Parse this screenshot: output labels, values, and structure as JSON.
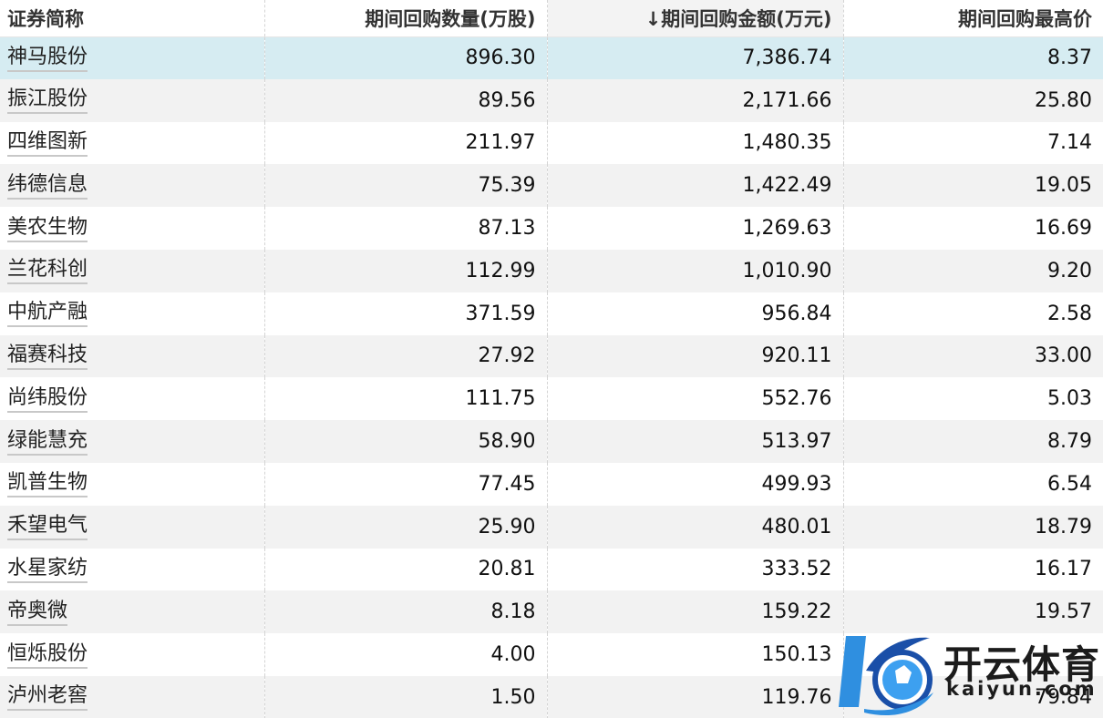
{
  "table": {
    "headers": {
      "name": "证券简称",
      "quantity": "期间回购数量(万股)",
      "amount": "↓期间回购金额(万元)",
      "max_price": "期间回购最高价"
    },
    "sorted_column": "amount",
    "rows": [
      {
        "name": "神马股份",
        "quantity": "896.30",
        "amount": "7,386.74",
        "max_price": "8.37",
        "selected": true
      },
      {
        "name": "振江股份",
        "quantity": "89.56",
        "amount": "2,171.66",
        "max_price": "25.80"
      },
      {
        "name": "四维图新",
        "quantity": "211.97",
        "amount": "1,480.35",
        "max_price": "7.14"
      },
      {
        "name": "纬德信息",
        "quantity": "75.39",
        "amount": "1,422.49",
        "max_price": "19.05"
      },
      {
        "name": "美农生物",
        "quantity": "87.13",
        "amount": "1,269.63",
        "max_price": "16.69"
      },
      {
        "name": "兰花科创",
        "quantity": "112.99",
        "amount": "1,010.90",
        "max_price": "9.20"
      },
      {
        "name": "中航产融",
        "quantity": "371.59",
        "amount": "956.84",
        "max_price": "2.58"
      },
      {
        "name": "福赛科技",
        "quantity": "27.92",
        "amount": "920.11",
        "max_price": "33.00"
      },
      {
        "name": "尚纬股份",
        "quantity": "111.75",
        "amount": "552.76",
        "max_price": "5.03"
      },
      {
        "name": "绿能慧充",
        "quantity": "58.90",
        "amount": "513.97",
        "max_price": "8.79"
      },
      {
        "name": "凯普生物",
        "quantity": "77.45",
        "amount": "499.93",
        "max_price": "6.54"
      },
      {
        "name": "禾望电气",
        "quantity": "25.90",
        "amount": "480.01",
        "max_price": "18.79"
      },
      {
        "name": "水星家纺",
        "quantity": "20.81",
        "amount": "333.52",
        "max_price": "16.17"
      },
      {
        "name": "帝奥微",
        "quantity": "8.18",
        "amount": "159.22",
        "max_price": "19.57"
      },
      {
        "name": "恒烁股份",
        "quantity": "4.00",
        "amount": "150.13",
        "max_price": ""
      },
      {
        "name": "泸州老窖",
        "quantity": "1.50",
        "amount": "119.76",
        "max_price": "79.84"
      }
    ]
  },
  "watermark": {
    "brand": "开云体育",
    "domain": "kaiyun.com",
    "colors": {
      "logo_blue": "#2f8fe0",
      "logo_dark": "#1a4fa8"
    }
  },
  "colors": {
    "selected_row": "#d6ecf2",
    "stripe_row": "#f2f2f2",
    "sorted_header": "#f3f3f3"
  }
}
